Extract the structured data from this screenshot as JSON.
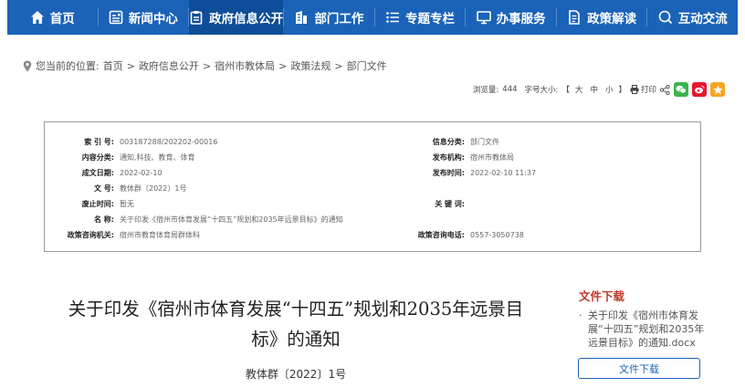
{
  "nav": {
    "items": [
      {
        "label": "首页"
      },
      {
        "label": "新闻中心"
      },
      {
        "label": "政府信息公开"
      },
      {
        "label": "部门工作"
      },
      {
        "label": "专题专栏"
      },
      {
        "label": "办事服务"
      },
      {
        "label": "政策解读"
      },
      {
        "label": "互动交流"
      }
    ]
  },
  "breadcrumb": {
    "prefix": "您当前的位置:",
    "items": [
      "首页",
      "政府信息公开",
      "宿州市教体局",
      "政策法规",
      "部门文件"
    ],
    "separator": ">"
  },
  "tools": {
    "views_label": "浏览量:",
    "views": "444",
    "fontsize_label": "字号大小:",
    "bracket_open": "【",
    "large": "大",
    "medium": "中",
    "small": "小",
    "bracket_close": "】",
    "print": "打印"
  },
  "meta": {
    "index_label": "索 引 号:",
    "index": "003187288/202202-00016",
    "category_label": "信息分类:",
    "category": "部门文件",
    "content_label": "内容分类:",
    "content": "通知,科技、教育、体育",
    "publisher_label": "发布机构:",
    "publisher": "宿州市教体局",
    "created_label": "成文日期:",
    "created": "2022-02-10",
    "published_label": "发布时间:",
    "published": "2022-02-10 11:37",
    "docno_label": "文 号:",
    "docno": "教体群〔2022〕1号",
    "expiry_label": "废止时间:",
    "expiry": "暂无",
    "keywords_label": "关 键 词:",
    "keywords": "",
    "name_label": "名 称:",
    "name": "关于印发《宿州市体育发展“十四五”规划和2035年远景目标》的通知",
    "dept_label": "政策咨询机关:",
    "dept": "宿州市教育体育局群体科",
    "phone_label": "政策咨询电话:",
    "phone": "0557-3050738"
  },
  "article": {
    "title_line1": "关于印发《宿州市体育发展“十四五”规划和2035年远景目",
    "title_line2": "标》的通知",
    "docno": "教体群〔2022〕1号"
  },
  "download": {
    "heading": "文件下载",
    "bullet": "·",
    "file": "关于印发《宿州市体育发展“十四五”规划和2035年远景目标》的通知.docx",
    "button": "文件下载"
  },
  "colors": {
    "nav_bg": "#1a63b8",
    "nav_active": "#0e4d98",
    "heading_red": "#c0392b",
    "wechat": "#3bb54a",
    "weibo": "#e6162d",
    "favorite": "#f5a623"
  }
}
